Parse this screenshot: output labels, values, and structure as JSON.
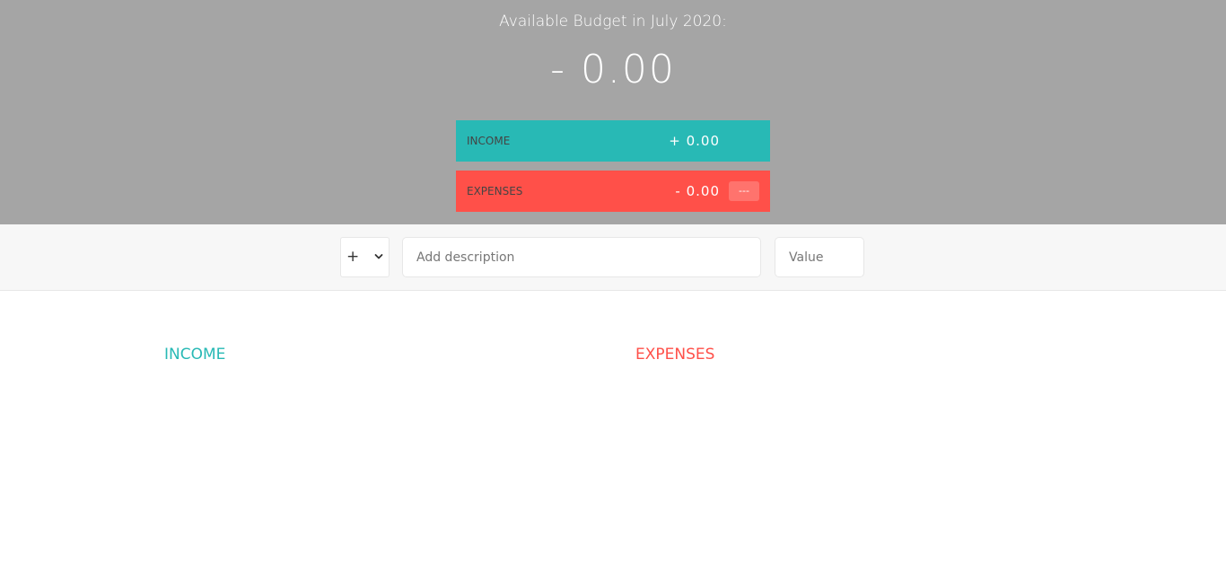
{
  "top": {
    "title": "Available Budget in July 2020:",
    "budget_value": "- 0.00",
    "income": {
      "label": "INCOME",
      "value": "+ 0.00",
      "color": "#28b9b5"
    },
    "expenses": {
      "label": "EXPENSES",
      "value": "- 0.00",
      "percentage": "---",
      "color": "#ff5049"
    }
  },
  "add": {
    "type_selected": "+",
    "type_icon": "chevron-down-icon",
    "description_placeholder": "Add description",
    "value_placeholder": "Value"
  },
  "lists": {
    "income_title": "INCOME",
    "expenses_title": "EXPENSES"
  },
  "colors": {
    "header_bg": "#a5a5a5",
    "income": "#28b9b5",
    "expenses": "#ff5049"
  }
}
